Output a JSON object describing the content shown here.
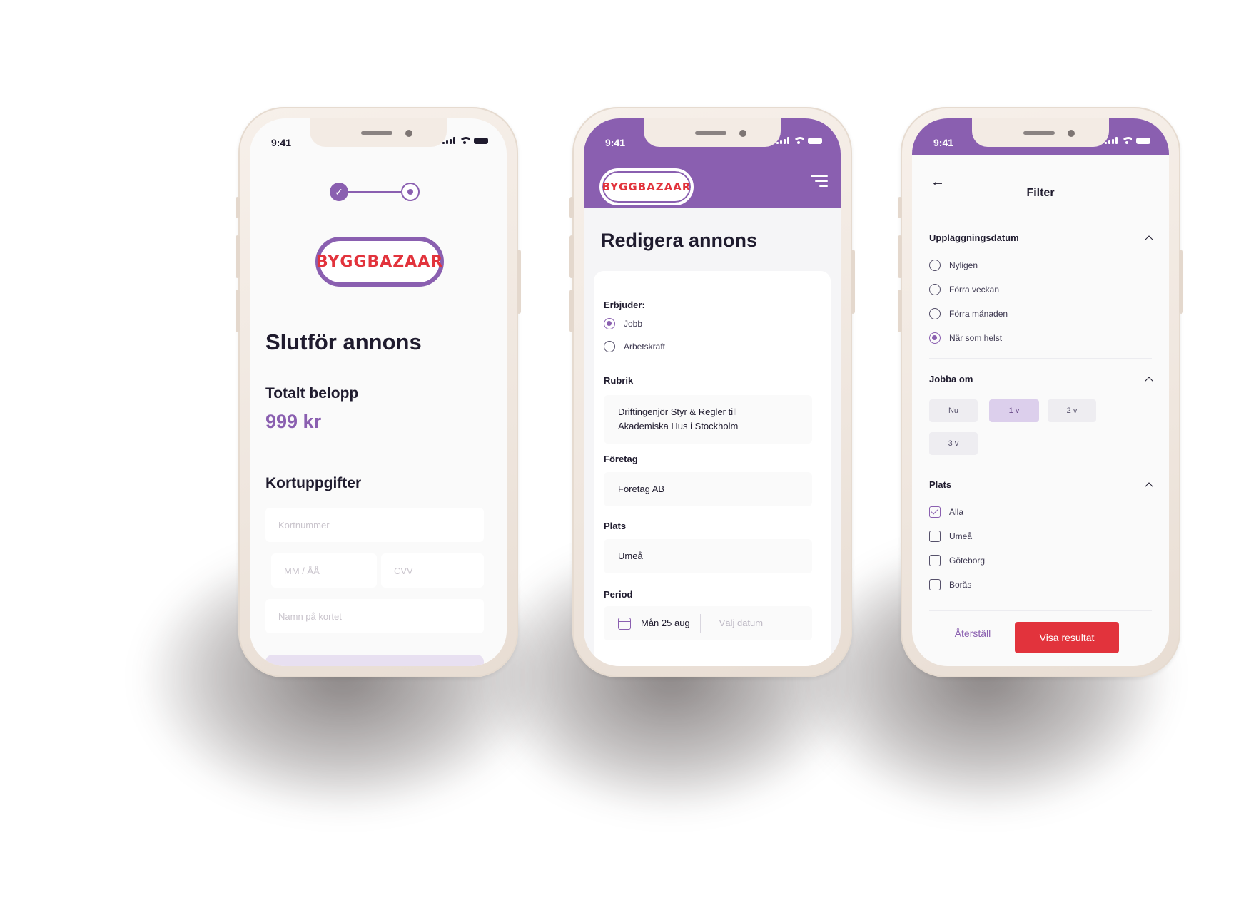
{
  "status": {
    "time": "9:41"
  },
  "brand": {
    "logo_text": "BYGGBAZAAR",
    "primary": "#8a5fb0",
    "accent": "#e2333c"
  },
  "checkout": {
    "title": "Slutför annons",
    "total_label": "Totalt belopp",
    "total_value": "999 kr",
    "card_section": "Kortuppgifter",
    "card_number_placeholder": "Kortnummer",
    "expiry_placeholder": "MM / ÅÅ",
    "cvv_placeholder": "CVV",
    "name_placeholder": "Namn på kortet",
    "step_icon": "check-icon"
  },
  "edit": {
    "title": "Redigera annons",
    "offers_label": "Erbjuder:",
    "offers_options": [
      "Jobb",
      "Arbetskraft"
    ],
    "offers_selected": "Jobb",
    "rubrik_label": "Rubrik",
    "rubrik_value": "Driftingenjör Styr & Regler till Akademiska Hus i Stockholm",
    "company_label": "Företag",
    "company_value": "Företag AB",
    "place_label": "Plats",
    "place_value": "Umeå",
    "period_label": "Period",
    "period_start": "Mån 25 aug",
    "period_end_placeholder": "Välj datum"
  },
  "filter": {
    "title": "Filter",
    "date_section": "Uppläggningsdatum",
    "date_options": [
      "Nyligen",
      "Förra veckan",
      "Förra månaden",
      "När som helst"
    ],
    "date_selected": "När som helst",
    "work_section": "Jobba om",
    "work_chips": [
      "Nu",
      "1 v",
      "2 v",
      "3 v"
    ],
    "work_selected": "1 v",
    "place_section": "Plats",
    "place_options": [
      "Alla",
      "Umeå",
      "Göteborg",
      "Borås"
    ],
    "place_checked": [
      "Alla"
    ],
    "reset_label": "Återställ",
    "show_label": "Visa resultat"
  }
}
